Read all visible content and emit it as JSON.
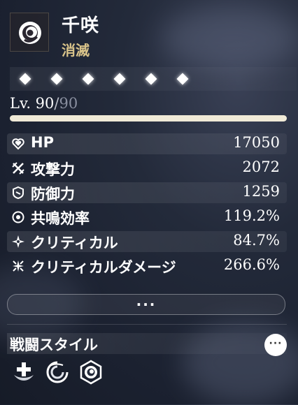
{
  "character": {
    "name": "千咲",
    "element": "消滅",
    "emblem_icon": "havoc-spiral-icon"
  },
  "sequence": {
    "nodes_total": 6,
    "nodes_unlocked": 6,
    "node_icon": "diamond-icon"
  },
  "level": {
    "prefix": "Lv. ",
    "current": "90",
    "separator": "/",
    "max": "90",
    "progress": 1.0
  },
  "stats": [
    {
      "icon": "heart-icon",
      "label": "HP",
      "value": "17050"
    },
    {
      "icon": "crossed-swords-icon",
      "label": "攻撃力",
      "value": "2072"
    },
    {
      "icon": "shield-icon",
      "label": "防御力",
      "value": "1259"
    },
    {
      "icon": "resonance-icon",
      "label": "共鳴効率",
      "value": "119.2%"
    },
    {
      "icon": "crit-star-icon",
      "label": "クリティカル",
      "value": "84.7%"
    },
    {
      "icon": "crit-damage-icon",
      "label": "クリティカルダメージ",
      "value": "266.6%"
    }
  ],
  "more_button": {
    "label": "···"
  },
  "combat_style": {
    "title": "戦闘スタイル",
    "more_label": "···",
    "icons": [
      "support-plus-icon",
      "swirl-icon",
      "havoc-spiral-icon"
    ]
  },
  "colors": {
    "element_text": "#d9c38a",
    "level_bar": "#f0ead7"
  }
}
